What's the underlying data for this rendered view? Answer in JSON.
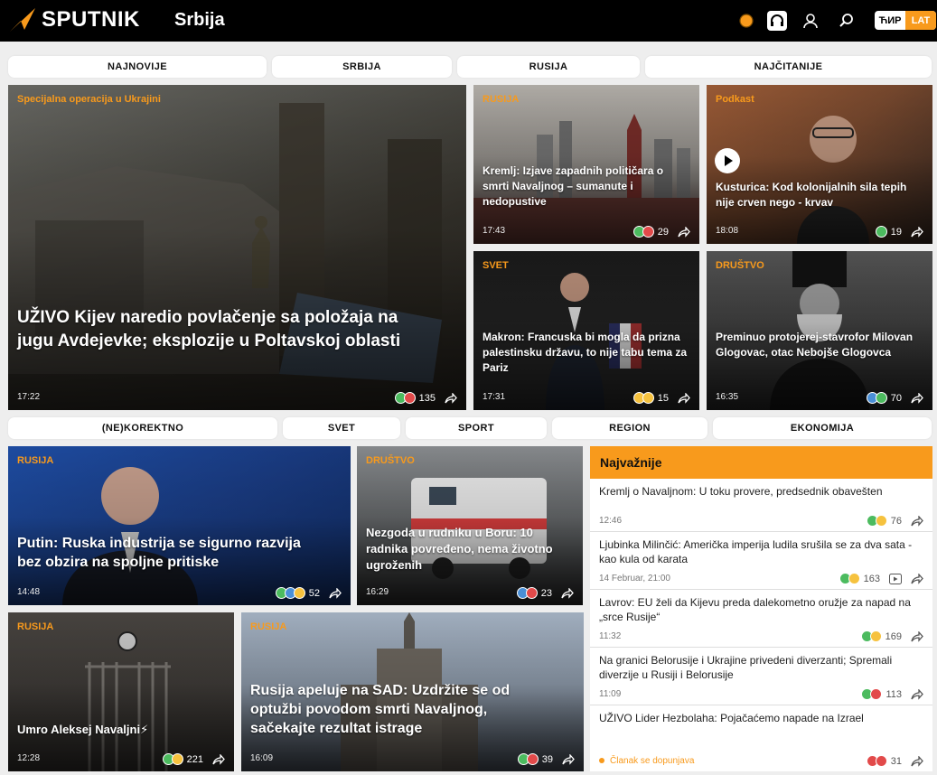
{
  "header": {
    "brand": "SPUTNIK",
    "edition": "Srbija",
    "lang_cyr": "ЋИР",
    "lang_lat": "LAT",
    "accent": "#f89a1c"
  },
  "nav_top": [
    "NAJNOVIJE",
    "SRBIJA",
    "RUSIJA",
    "NAJČITANIJE"
  ],
  "nav_mid": [
    "(NE)KOREKTNO",
    "SVET",
    "SPORT",
    "REGION",
    "EKONOMIJA"
  ],
  "cards": {
    "hero": {
      "category": "Specijalna operacija u Ukrajini",
      "title": "UŽIVO Kijev naredio povlačenje sa položaja na jugu Avdejevke; eksplozije u Poltavskoj oblasti",
      "time": "17:22",
      "count": "135"
    },
    "kremlj": {
      "category": "RUSIJA",
      "title": "Kremlj: Izjave zapadnih političara o smrti Navaljnog – sumanute i nedopustive",
      "time": "17:43",
      "count": "29"
    },
    "kusturica": {
      "category": "Podkast",
      "title": "Kusturica: Kod kolonijalnih sila tepih nije crven nego - krvav",
      "time": "18:08",
      "count": "19"
    },
    "makron": {
      "category": "SVET",
      "title": "Makron: Francuska bi mogla da prizna palestinsku državu, to nije tabu tema za Pariz",
      "time": "17:31",
      "count": "15"
    },
    "glogovac": {
      "category": "DRUŠTVO",
      "title": "Preminuo protojerej-stavrofor Milovan Glogovac, otac Nebojše Glogovca",
      "time": "16:35",
      "count": "70"
    },
    "putin": {
      "category": "RUSIJA",
      "title": "Putin: Ruska industrija se sigurno razvija bez obzira na spoljne pritiske",
      "time": "14:48",
      "count": "52"
    },
    "bor": {
      "category": "DRUŠTVO",
      "title": "Nezgoda u rudniku u Boru: 10 radnika povređeno, nema životno ugroženih",
      "time": "16:29",
      "count": "23"
    },
    "navaljni": {
      "category": "RUSIJA",
      "title": "Umro Aleksej Navaljni⚡",
      "time": "12:28",
      "count": "221"
    },
    "sad": {
      "category": "RUSIJA",
      "title": "Rusija apeluje na SAD: Uzdržite se od optužbi povodom smrti Navaljnog, sačekajte rezultat istrage",
      "time": "16:09",
      "count": "39"
    }
  },
  "panel": {
    "heading": "Najvažnije",
    "items": [
      {
        "title": "Kremlj o Navaljnom: U toku provere, predsednik obavešten",
        "date": "12:46",
        "count": "76"
      },
      {
        "title": "Ljubinka Milinčić: Američka imperija ludila srušila se za dva sata - kao kula od karata",
        "date": "14 Februar, 21:00",
        "count": "163"
      },
      {
        "title": "Lavrov: EU želi da Kijevu preda dalekometno oružje za napad na „srce Rusije“",
        "date": "11:32",
        "count": "169"
      },
      {
        "title": "Na granici Belorusije i Ukrajine privedeni diverzanti; Spremali diverzije u Rusiji i Belorusije",
        "date": "11:09",
        "count": "113"
      },
      {
        "title": "UŽIVO Lider Hezbolaha: Pojačaćemo napade na Izrael",
        "date": "Članak se dopunjava",
        "count": "31"
      }
    ]
  }
}
